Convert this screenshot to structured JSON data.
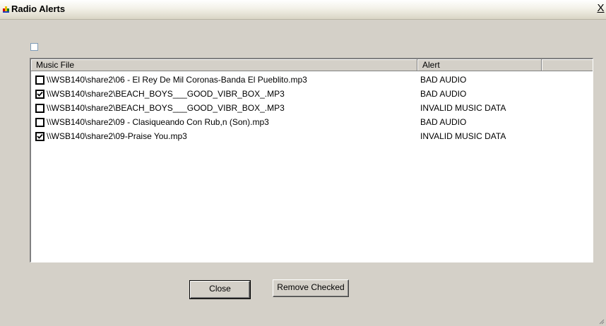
{
  "window": {
    "title": "Radio Alerts",
    "close_glyph": "X",
    "app_icon": "radio-alerts-icon",
    "title_bar_color": "#f3f1e8",
    "body_color": "#d4d0c8"
  },
  "select_all": {
    "checked": false
  },
  "list": {
    "columns": [
      "Music File",
      "Alert",
      ""
    ],
    "rows": [
      {
        "checked": false,
        "file": "\\\\WSB140\\share2\\06 - El Rey De Mil Coronas-Banda El Pueblito.mp3",
        "alert": "BAD AUDIO"
      },
      {
        "checked": true,
        "file": "\\\\WSB140\\share2\\BEACH_BOYS___GOOD_VIBR_BOX_.MP3",
        "alert": "BAD AUDIO"
      },
      {
        "checked": false,
        "file": "\\\\WSB140\\share2\\BEACH_BOYS___GOOD_VIBR_BOX_.MP3",
        "alert": "INVALID MUSIC DATA"
      },
      {
        "checked": false,
        "file": "\\\\WSB140\\share2\\09 - Clasiqueando Con Rub,n (Son).mp3",
        "alert": "BAD AUDIO"
      },
      {
        "checked": true,
        "file": "\\\\WSB140\\share2\\09-Praise You.mp3",
        "alert": "INVALID MUSIC DATA"
      }
    ]
  },
  "buttons": {
    "close": "Close",
    "remove_checked": "Remove Checked"
  }
}
